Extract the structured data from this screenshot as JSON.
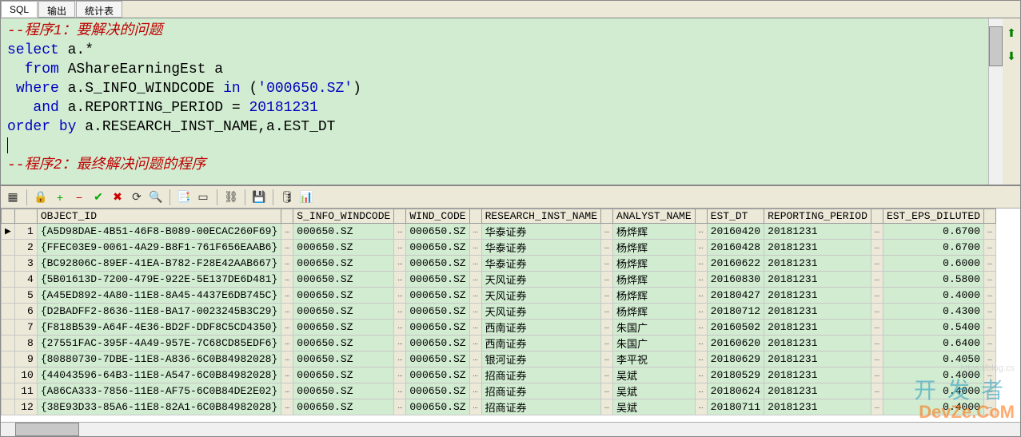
{
  "tabs": {
    "sql": "SQL",
    "output": "输出",
    "stats": "统计表"
  },
  "sql": {
    "comment1": "--程序1：要解决的问题",
    "l2_kw1": "select",
    "l2_id": " a.*",
    "l3_kw1": "from",
    "l3_id": " AShareEarningEst a",
    "l4_kw1": "where",
    "l4_id1": " a.S_INFO_WINDCODE ",
    "l4_kw2": "in",
    "l4_paren1": " (",
    "l4_str": "'000650.SZ'",
    "l4_paren2": ")",
    "l5_kw1": "and",
    "l5_id": " a.REPORTING_PERIOD = ",
    "l5_num": "20181231",
    "l6_kw1": "order",
    "l6_kw2": " by",
    "l6_id": " a.RESEARCH_INST_NAME,a.EST_DT",
    "spacer": "",
    "comment2": "--程序2：最终解决问题的程序"
  },
  "columns": {
    "c0": "OBJECT_ID",
    "c1": "S_INFO_WINDCODE",
    "c2": "WIND_CODE",
    "c3": "RESEARCH_INST_NAME",
    "c4": "ANALYST_NAME",
    "c5": "EST_DT",
    "c6": "REPORTING_PERIOD",
    "c7": "EST_EPS_DILUTED"
  },
  "rows": [
    {
      "n": "1",
      "obj": "{A5D98DAE-4B51-46F8-B089-00ECAC260F69}",
      "w": "000650.SZ",
      "wc": "000650.SZ",
      "inst": "华泰证券",
      "an": "杨烨辉",
      "dt": "20160420",
      "rp": "20181231",
      "eps": "0.6700"
    },
    {
      "n": "2",
      "obj": "{FFEC03E9-0061-4A29-B8F1-761F656EAAB6}",
      "w": "000650.SZ",
      "wc": "000650.SZ",
      "inst": "华泰证券",
      "an": "杨烨辉",
      "dt": "20160428",
      "rp": "20181231",
      "eps": "0.6700"
    },
    {
      "n": "3",
      "obj": "{BC92806C-89EF-41EA-B782-F28E42AAB667}",
      "w": "000650.SZ",
      "wc": "000650.SZ",
      "inst": "华泰证券",
      "an": "杨烨辉",
      "dt": "20160622",
      "rp": "20181231",
      "eps": "0.6000"
    },
    {
      "n": "4",
      "obj": "{5B01613D-7200-479E-922E-5E137DE6D481}",
      "w": "000650.SZ",
      "wc": "000650.SZ",
      "inst": "天风证券",
      "an": "杨烨辉",
      "dt": "20160830",
      "rp": "20181231",
      "eps": "0.5800"
    },
    {
      "n": "5",
      "obj": "{A45ED892-4A80-11E8-8A45-4437E6DB745C}",
      "w": "000650.SZ",
      "wc": "000650.SZ",
      "inst": "天风证券",
      "an": "杨烨辉",
      "dt": "20180427",
      "rp": "20181231",
      "eps": "0.4000"
    },
    {
      "n": "6",
      "obj": "{D2BADFF2-8636-11E8-BA17-0023245B3C29}",
      "w": "000650.SZ",
      "wc": "000650.SZ",
      "inst": "天风证券",
      "an": "杨烨辉",
      "dt": "20180712",
      "rp": "20181231",
      "eps": "0.4300"
    },
    {
      "n": "7",
      "obj": "{F818B539-A64F-4E36-BD2F-DDF8C5CD4350}",
      "w": "000650.SZ",
      "wc": "000650.SZ",
      "inst": "西南证券",
      "an": "朱国广",
      "dt": "20160502",
      "rp": "20181231",
      "eps": "0.5400"
    },
    {
      "n": "8",
      "obj": "{27551FAC-395F-4A49-957E-7C68CD85EDF6}",
      "w": "000650.SZ",
      "wc": "000650.SZ",
      "inst": "西南证券",
      "an": "朱国广",
      "dt": "20160620",
      "rp": "20181231",
      "eps": "0.6400"
    },
    {
      "n": "9",
      "obj": "{80880730-7DBE-11E8-A836-6C0B84982028}",
      "w": "000650.SZ",
      "wc": "000650.SZ",
      "inst": "银河证券",
      "an": "李平祝",
      "dt": "20180629",
      "rp": "20181231",
      "eps": "0.4050"
    },
    {
      "n": "10",
      "obj": "{44043596-64B3-11E8-A547-6C0B84982028}",
      "w": "000650.SZ",
      "wc": "000650.SZ",
      "inst": "招商证券",
      "an": "吴斌",
      "dt": "20180529",
      "rp": "20181231",
      "eps": "0.4000"
    },
    {
      "n": "11",
      "obj": "{A86CA333-7856-11E8-AF75-6C0B84DE2E02}",
      "w": "000650.SZ",
      "wc": "000650.SZ",
      "inst": "招商证券",
      "an": "吴斌",
      "dt": "20180624",
      "rp": "20181231",
      "eps": "0.4000"
    },
    {
      "n": "12",
      "obj": "{38E93D33-85A6-11E8-82A1-6C0B84982028}",
      "w": "000650.SZ",
      "wc": "000650.SZ",
      "inst": "招商证券",
      "an": "吴斌",
      "dt": "20180711",
      "rp": "20181231",
      "eps": "0.4000"
    }
  ],
  "dots": "…",
  "watermark": {
    "cn": "开发者",
    "en": "DevZe.CoM",
    "url": "https://blog.cs"
  }
}
